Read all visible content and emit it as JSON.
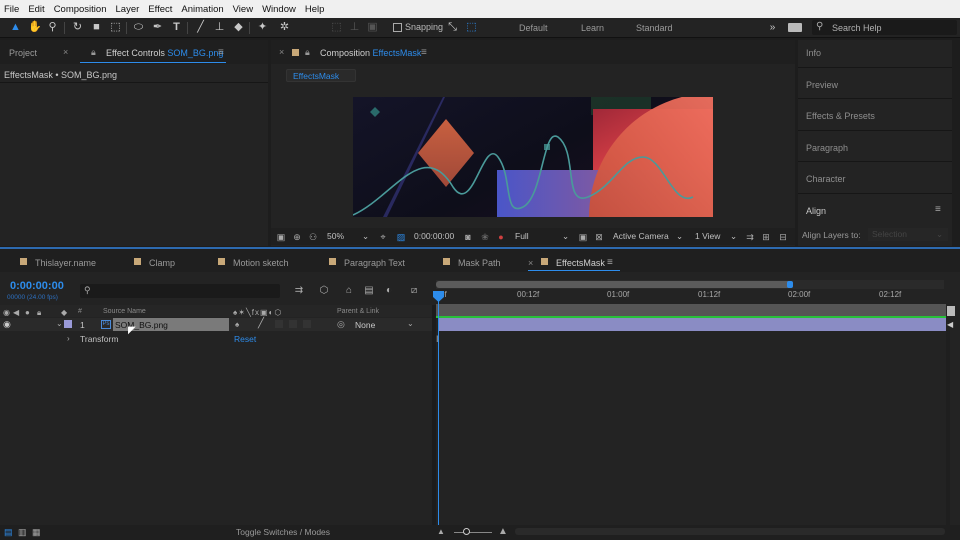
{
  "menu": [
    "File",
    "Edit",
    "Composition",
    "Layer",
    "Effect",
    "Animation",
    "View",
    "Window",
    "Help"
  ],
  "toolbar": {
    "snapping_label": "Snapping",
    "workspaces": [
      "Default",
      "Learn",
      "Standard"
    ],
    "search_placeholder": "Search Help"
  },
  "left_panel": {
    "tab_project": "Project",
    "tab_effect_controls_prefix": "Effect Controls",
    "tab_effect_controls_layer": "SOM_BG.png",
    "subheader": "EffectsMask • SOM_BG.png"
  },
  "composition_panel": {
    "tab_prefix": "Composition",
    "tab_name": "EffectsMask",
    "sub_tab": "EffectsMask",
    "zoom": "50%",
    "timecode": "0:00:00:00",
    "resolution": "Full",
    "camera": "Active Camera",
    "view": "1 View"
  },
  "right_panel": {
    "items": [
      "Info",
      "Preview",
      "Effects & Presets",
      "Paragraph",
      "Character"
    ],
    "align_title": "Align",
    "align_layers_to": "Align Layers to:",
    "align_value": "Selection"
  },
  "timeline": {
    "tabs": [
      {
        "name": "Thislayer.name",
        "color": "#c8a878"
      },
      {
        "name": "Clamp",
        "color": "#c8a878"
      },
      {
        "name": "Motion sketch",
        "color": "#c8a878"
      },
      {
        "name": "Paragraph Text",
        "color": "#c8a878"
      },
      {
        "name": "Mask Path",
        "color": "#c8a878"
      },
      {
        "name": "EffectsMask",
        "color": "#c8a878"
      }
    ],
    "timecode": "0:00:00:00",
    "frame_info": "00000 (24.00 fps)",
    "col_hash": "#",
    "col_source_name": "Source Name",
    "col_parent": "Parent & Link",
    "layer_number": "1",
    "layer_name": "SOM_BG.png",
    "parent_value": "None",
    "transform_label": "Transform",
    "reset_label": "Reset",
    "ruler": [
      "0f",
      "00:12f",
      "01:00f",
      "01:12f",
      "02:00f",
      "02:12f"
    ],
    "toggle_label": "Toggle Switches / Modes"
  },
  "colors": {
    "accent": "#2d8ceb",
    "layer_bar": "#8a8cc4",
    "work_area": "#5b5b5b",
    "green_line": "#27c13a"
  }
}
